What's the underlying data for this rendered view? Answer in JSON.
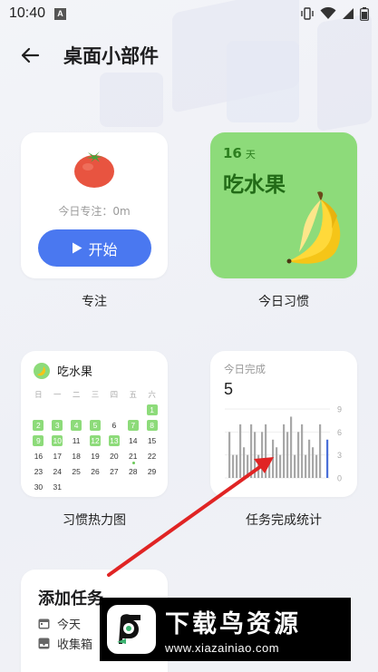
{
  "status_bar": {
    "time": "10:40",
    "notification_icon": "A"
  },
  "header": {
    "title": "桌面小部件"
  },
  "widgets": {
    "focus": {
      "focus_text": "今日专注：0m",
      "start_label": "开始",
      "caption": "专注"
    },
    "habit": {
      "days": "16",
      "days_unit": "天",
      "name": "吃水果",
      "caption": "今日习惯"
    },
    "heatmap": {
      "habit_name": "吃水果",
      "weekdays": [
        "日",
        "一",
        "二",
        "三",
        "四",
        "五",
        "六"
      ],
      "rows": [
        [
          "",
          "",
          "",
          "",
          "",
          "",
          "1"
        ],
        [
          "2",
          "3",
          "4",
          "5",
          "6",
          "7",
          "8"
        ],
        [
          "9",
          "10",
          "11",
          "12",
          "13",
          "14",
          "15"
        ],
        [
          "16",
          "17",
          "18",
          "19",
          "20",
          "21",
          "22"
        ],
        [
          "23",
          "24",
          "25",
          "26",
          "27",
          "28",
          "29"
        ],
        [
          "30",
          "31",
          "",
          "",
          "",
          "",
          ""
        ]
      ],
      "done_days": [
        "1",
        "2",
        "3",
        "4",
        "5",
        "7",
        "8",
        "9",
        "10",
        "12",
        "13"
      ],
      "today": "21",
      "caption": "习惯热力图"
    },
    "stats": {
      "label": "今日完成",
      "value": "5",
      "y_ticks": [
        "9",
        "6",
        "3",
        "0"
      ],
      "caption": "任务完成统计"
    },
    "add_task": {
      "title": "添加任务",
      "items": [
        "今天",
        "收集箱"
      ]
    }
  },
  "chart_data": {
    "type": "bar",
    "title": "今日完成",
    "ylim": [
      0,
      9
    ],
    "y_ticks": [
      0,
      3,
      6,
      9
    ],
    "values": [
      6,
      3,
      3,
      7,
      4,
      3,
      7,
      6,
      3,
      6,
      7,
      2,
      5,
      4,
      3,
      7,
      6,
      8,
      3,
      6,
      7,
      3,
      5,
      4,
      3,
      7,
      0,
      5
    ],
    "highlight_index": 27,
    "colors": {
      "bar": "#a8a8a8",
      "highlight": "#4a6fd8"
    }
  },
  "watermark": {
    "title": "下载鸟资源",
    "url": "www.xiazainiao.com"
  },
  "colors": {
    "accent_blue": "#4a78f0",
    "habit_green": "#8ddb7a",
    "annotation_red": "#e02424"
  }
}
